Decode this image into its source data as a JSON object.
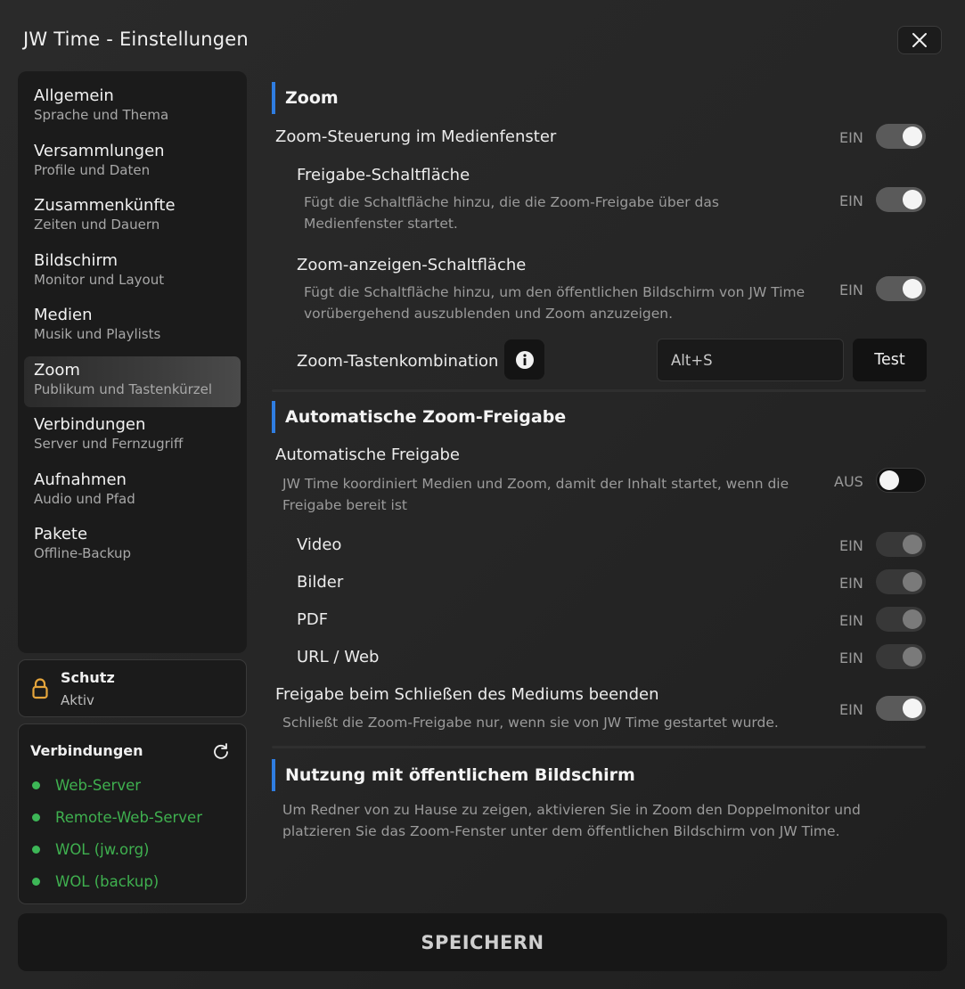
{
  "window": {
    "title": "JW Time - Einstellungen"
  },
  "sidebar": {
    "items": [
      {
        "label": "Allgemein",
        "sub": "Sprache und Thema"
      },
      {
        "label": "Versammlungen",
        "sub": "Profile und Daten"
      },
      {
        "label": "Zusammenkünfte",
        "sub": "Zeiten und Dauern"
      },
      {
        "label": "Bildschirm",
        "sub": "Monitor und Layout"
      },
      {
        "label": "Medien",
        "sub": "Musik und Playlists"
      },
      {
        "label": "Zoom",
        "sub": "Publikum und Tastenkürzel",
        "active": true
      },
      {
        "label": "Verbindungen",
        "sub": "Server und Fernzugriff"
      },
      {
        "label": "Aufnahmen",
        "sub": "Audio und Pfad"
      },
      {
        "label": "Pakete",
        "sub": "Offline-Backup"
      }
    ]
  },
  "protection": {
    "title": "Schutz",
    "status": "Aktiv"
  },
  "connections": {
    "title": "Verbindungen",
    "items": [
      {
        "label": "Web-Server",
        "status_color": "#3db757"
      },
      {
        "label": "Remote-Web-Server",
        "status_color": "#3db757"
      },
      {
        "label": "WOL (jw.org)",
        "status_color": "#3db757"
      },
      {
        "label": "WOL (backup)",
        "status_color": "#3db757"
      }
    ]
  },
  "zoom": {
    "heading": "Zoom",
    "media_control": {
      "label": "Zoom-Steuerung im Medienfenster",
      "state": "EIN"
    },
    "share_button": {
      "label": "Freigabe-Schaltfläche",
      "desc_line1": "Fügt die Schaltfläche hinzu, die die Zoom-Freigabe über das",
      "desc_line2": "Medienfenster startet.",
      "state": "EIN"
    },
    "show_button": {
      "label": "Zoom-anzeigen-Schaltfläche",
      "desc_line1": "Fügt die Schaltfläche hinzu, um den öffentlichen Bildschirm von JW Time",
      "desc_line2": "vorübergehend auszublenden und Zoom anzuzeigen.",
      "state": "EIN"
    },
    "shortcut": {
      "label": "Zoom-Tastenkombination",
      "value": "Alt+S",
      "test_label": "Test"
    }
  },
  "auto_share": {
    "heading": "Automatische Zoom-Freigabe",
    "auto": {
      "label": "Automatische Freigabe",
      "desc_line1": "JW Time koordiniert Medien und Zoom, damit der Inhalt startet, wenn die",
      "desc_line2": "Freigabe bereit ist",
      "state": "AUS"
    },
    "types": [
      {
        "label": "Video",
        "state": "EIN"
      },
      {
        "label": "Bilder",
        "state": "EIN"
      },
      {
        "label": "PDF",
        "state": "EIN"
      },
      {
        "label": "URL / Web",
        "state": "EIN"
      }
    ],
    "end_on_close": {
      "label": "Freigabe beim Schließen des Mediums beenden",
      "desc": "Schließt die Zoom-Freigabe nur, wenn sie von JW Time gestartet wurde.",
      "state": "EIN"
    }
  },
  "public_screen": {
    "heading": "Nutzung mit öffentlichem Bildschirm",
    "desc_line1": "Um Redner von zu Hause zu zeigen, aktivieren Sie in Zoom den Doppelmonitor und",
    "desc_line2": "platzieren Sie das Zoom-Fenster unter dem öffentlichen Bildschirm von JW Time."
  },
  "footer": {
    "save_label": "SPEICHERN"
  },
  "colors": {
    "accent": "#2f7de1",
    "status_ok": "#3db757"
  }
}
